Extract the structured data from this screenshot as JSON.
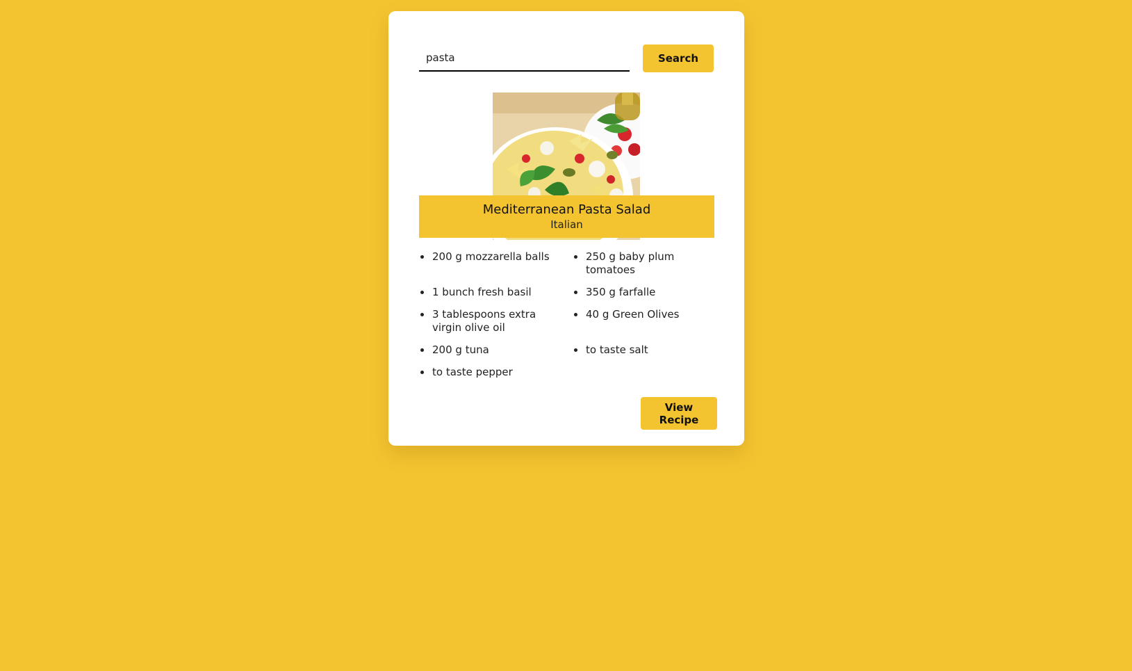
{
  "search": {
    "value": "pasta",
    "button_label": "Search"
  },
  "recipe": {
    "image_alt": "Mediterranean Pasta Salad",
    "title": "Mediterranean Pasta Salad",
    "cuisine": "Italian",
    "ingredients": [
      "200 g mozzarella balls",
      "250 g baby plum tomatoes",
      "1 bunch fresh basil",
      "350 g farfalle",
      "3 tablespoons extra virgin olive oil",
      "40 g Green Olives",
      "200 g tuna",
      "to taste salt",
      "to taste pepper"
    ],
    "view_label": "View Recipe"
  },
  "colors": {
    "background": "#f4c430",
    "card": "#ffffff",
    "accent": "#f4c430",
    "text": "#222222"
  }
}
